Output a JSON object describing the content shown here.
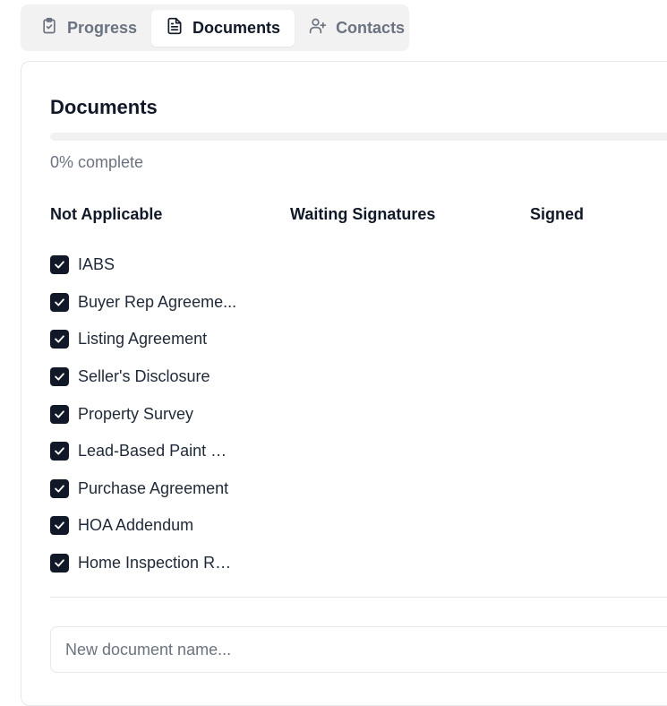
{
  "tabs": [
    {
      "label": "Progress",
      "icon": "clipboard-check-icon",
      "active": false
    },
    {
      "label": "Documents",
      "icon": "document-icon",
      "active": true
    },
    {
      "label": "Contacts",
      "icon": "user-plus-icon",
      "active": false
    }
  ],
  "card": {
    "title": "Documents",
    "progress_value": 0,
    "progress_text": "0% complete",
    "columns": [
      "Not Applicable",
      "Waiting Signatures",
      "Signed"
    ],
    "documents": [
      {
        "label": "IABS",
        "checked": true
      },
      {
        "label": "Buyer Rep Agreeme...",
        "checked": true
      },
      {
        "label": "Listing Agreement",
        "checked": true
      },
      {
        "label": "Seller's Disclosure",
        "checked": true
      },
      {
        "label": "Property Survey",
        "checked": true
      },
      {
        "label": "Lead-Based Paint Di...",
        "checked": true
      },
      {
        "label": "Purchase Agreement",
        "checked": true
      },
      {
        "label": "HOA Addendum",
        "checked": true
      },
      {
        "label": "Home Inspection Re...",
        "checked": true
      }
    ],
    "new_document_placeholder": "New document name...",
    "new_document_value": ""
  },
  "colors": {
    "accent": "#111827",
    "muted_text": "#6b7280",
    "border": "#e5e7eb",
    "tab_bar_bg": "#f2f2f2"
  }
}
